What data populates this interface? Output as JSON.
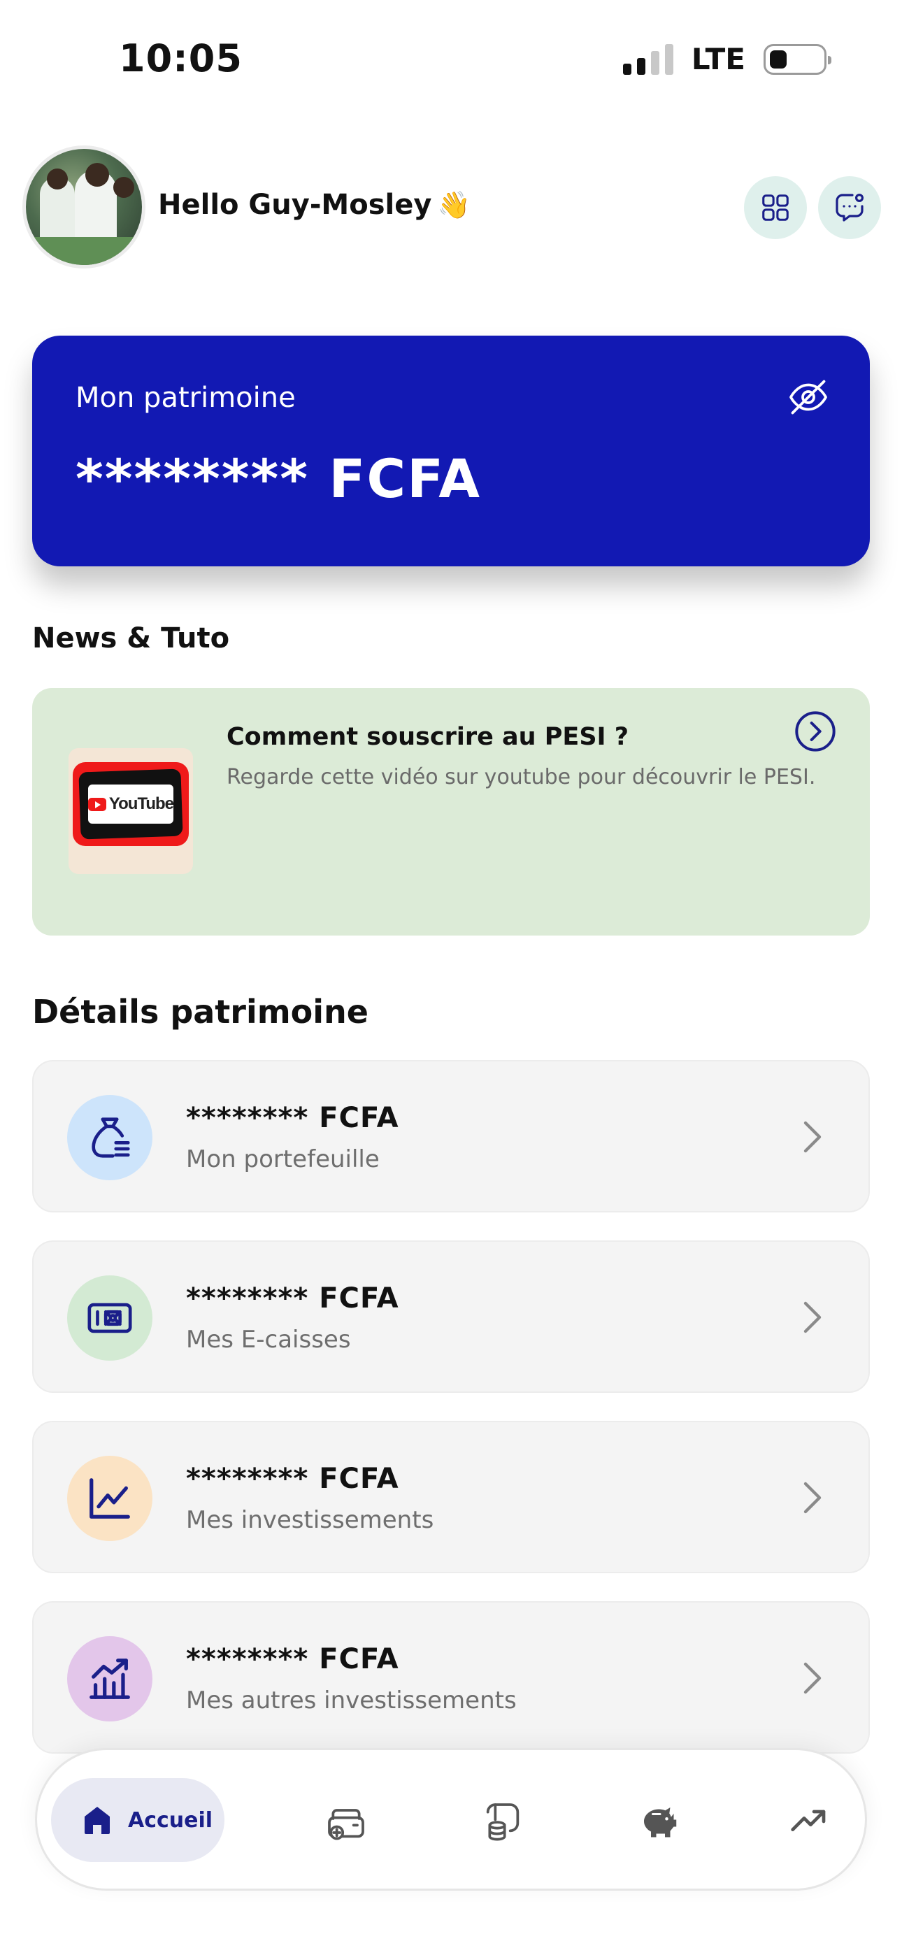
{
  "status_bar": {
    "time": "10:05",
    "network": "LTE"
  },
  "header": {
    "greeting": "Hello Guy-Mosley",
    "wave_emoji": "👋"
  },
  "patrimoine_card": {
    "label": "Mon patrimoine",
    "amount": "******** FCFA",
    "color": "#1219b3"
  },
  "news": {
    "section_title": "News & Tuto",
    "card": {
      "title": "Comment souscrire au  PESI ?",
      "description": "Regarde cette vidéo sur youtube pour découvrir le PESI.",
      "thumbnail_logo": "YouTube"
    }
  },
  "details": {
    "section_title": "Détails patrimoine",
    "items": [
      {
        "amount": "******** FCFA",
        "label": "Mon portefeuille",
        "icon": "money-bag-icon",
        "icon_bg": "#cde4fb"
      },
      {
        "amount": "******** FCFA",
        "label": "Mes E-caisses",
        "icon": "cash-register-icon",
        "icon_bg": "#d3ead3"
      },
      {
        "amount": "******** FCFA",
        "label": "Mes investissements",
        "icon": "line-chart-icon",
        "icon_bg": "#fbe3c4"
      },
      {
        "amount": "******** FCFA",
        "label": "Mes autres investissements",
        "icon": "bar-chart-icon",
        "icon_bg": "#e3c6ea"
      }
    ]
  },
  "bottom_nav": {
    "active_label": "Accueil",
    "items": [
      "home-icon",
      "wallet-add-icon",
      "coins-icon",
      "piggy-bank-icon",
      "trending-up-icon"
    ]
  },
  "colors": {
    "primary": "#1219b3",
    "icon_dark": "#1a1f8a",
    "news_bg": "#dcebd7"
  }
}
